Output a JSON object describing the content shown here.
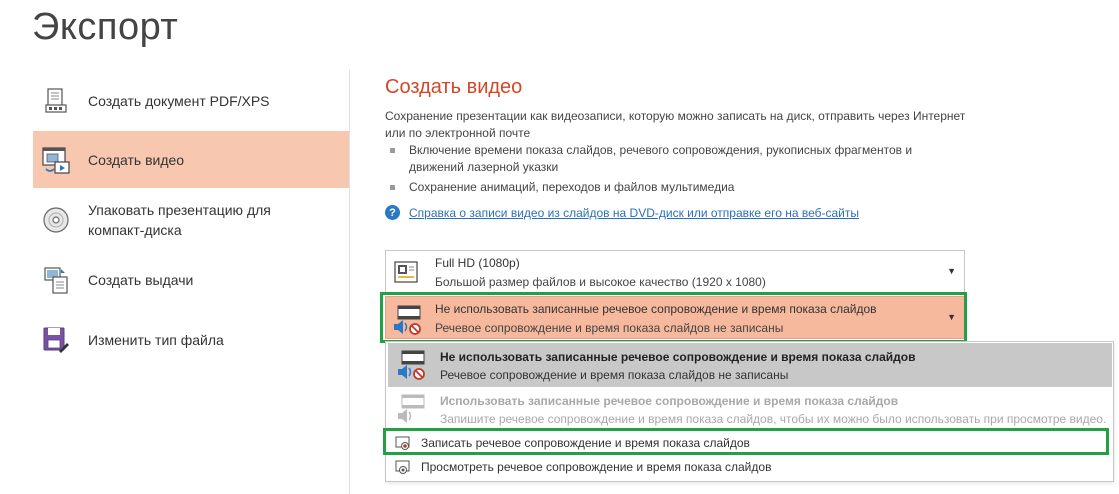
{
  "page": {
    "title": "Экспорт"
  },
  "nav": {
    "items": [
      {
        "label": "Создать документ PDF/XPS",
        "icon": "pdf-document-icon"
      },
      {
        "label": "Создать видео",
        "icon": "video-icon",
        "selected": true
      },
      {
        "label": "Упаковать презентацию для компакт-диска",
        "icon": "cd-icon"
      },
      {
        "label": "Создать выдачи",
        "icon": "handouts-icon"
      },
      {
        "label": "Изменить тип файла",
        "icon": "change-file-type-icon"
      }
    ]
  },
  "main": {
    "title": "Создать видео",
    "description": "Сохранение презентации как видеозаписи, которую можно записать на диск, отправить через Интернет или по электронной почте",
    "bullets": [
      "Включение времени показа слайдов, речевого сопровождения, рукописных фрагментов и движений лазерной указки",
      "Сохранение анимаций, переходов и файлов мультимедиа"
    ],
    "help_link": "Справка о записи видео из слайдов на DVD-диск или отправке его на веб-сайты"
  },
  "quality_dropdown": {
    "title": "Full HD (1080p)",
    "subtitle": "Большой размер файлов и высокое качество (1920 x 1080)"
  },
  "narration_dropdown": {
    "title": "Не использовать записанные речевое сопровождение и время показа слайдов",
    "subtitle": "Речевое сопровождение и время показа слайдов не записаны"
  },
  "menu": {
    "options": [
      {
        "title": "Не использовать записанные речевое сопровождение и время показа слайдов",
        "subtitle": "Речевое сопровождение и время показа слайдов не записаны"
      },
      {
        "title": "Использовать записанные речевое сопровождение и время показа слайдов",
        "subtitle": "Запишите речевое сопровождение и время показа слайдов, чтобы их можно было использовать при просмотре видео."
      }
    ],
    "record": "Записать речевое сопровождение и время показа слайдов",
    "preview": "Просмотреть речевое сопровождение и время показа слайдов"
  },
  "colors": {
    "accent": "#d24726",
    "selected_bg": "#f8c7b0",
    "highlight_outline": "#22a043",
    "link": "#2b6fb8"
  }
}
